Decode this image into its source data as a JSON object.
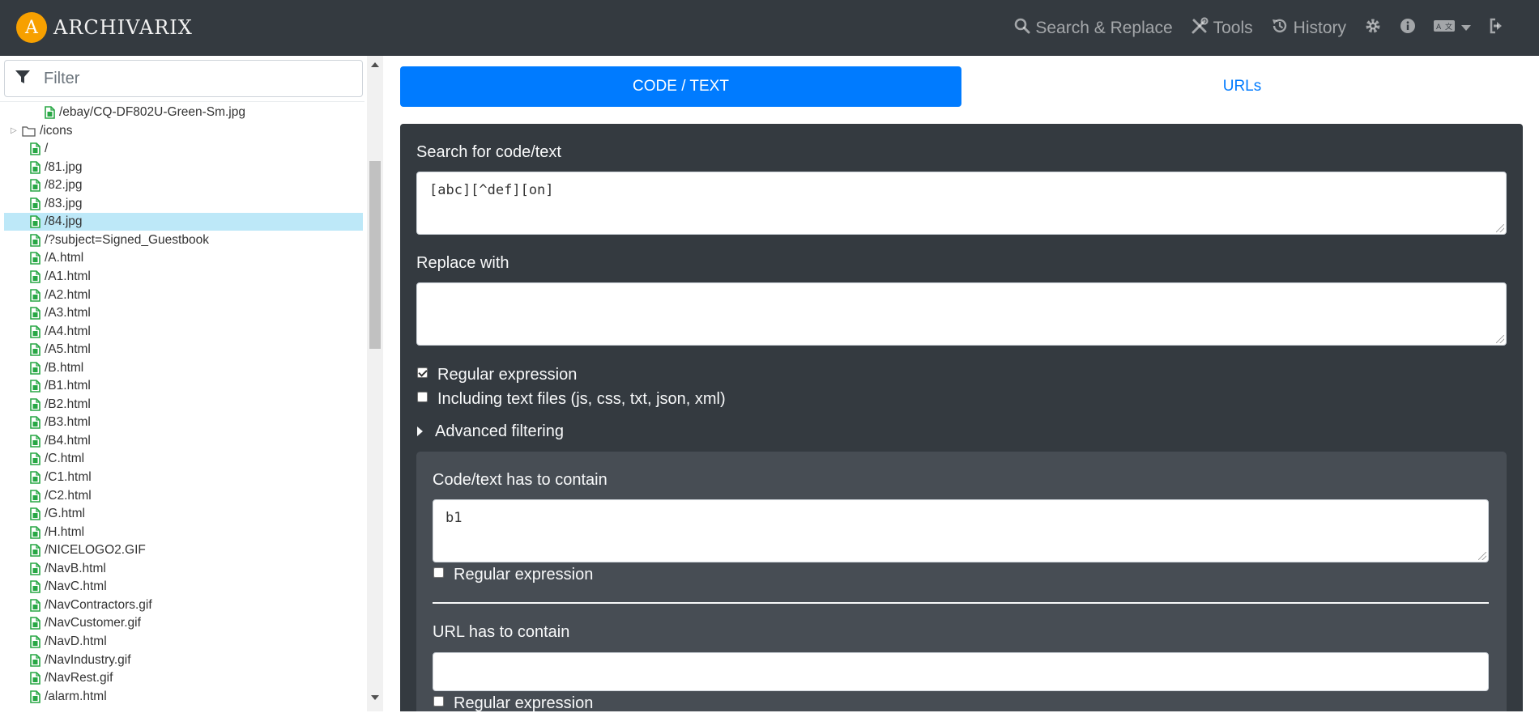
{
  "brand": {
    "logo_letter": "A",
    "name": "ARCHIVARIX",
    "logo_color": "#f7a000"
  },
  "nav": {
    "search_replace": "Search & Replace",
    "tools": "Tools",
    "history": "History"
  },
  "sidebar": {
    "filter_placeholder": "Filter",
    "items": [
      {
        "label": "/ebay/CQ-DF802U-Green-Sm.jpg",
        "type": "file",
        "indent": 2,
        "selected": false
      },
      {
        "label": "/icons",
        "type": "folder",
        "indent": 1,
        "selected": false
      },
      {
        "label": "/",
        "type": "file",
        "indent": 1,
        "selected": false
      },
      {
        "label": "/81.jpg",
        "type": "file",
        "indent": 1,
        "selected": false
      },
      {
        "label": "/82.jpg",
        "type": "file",
        "indent": 1,
        "selected": false
      },
      {
        "label": "/83.jpg",
        "type": "file",
        "indent": 1,
        "selected": false
      },
      {
        "label": "/84.jpg",
        "type": "file",
        "indent": 1,
        "selected": true
      },
      {
        "label": "/?subject=Signed_Guestbook",
        "type": "file",
        "indent": 1,
        "selected": false
      },
      {
        "label": "/A.html",
        "type": "file",
        "indent": 1,
        "selected": false
      },
      {
        "label": "/A1.html",
        "type": "file",
        "indent": 1,
        "selected": false
      },
      {
        "label": "/A2.html",
        "type": "file",
        "indent": 1,
        "selected": false
      },
      {
        "label": "/A3.html",
        "type": "file",
        "indent": 1,
        "selected": false
      },
      {
        "label": "/A4.html",
        "type": "file",
        "indent": 1,
        "selected": false
      },
      {
        "label": "/A5.html",
        "type": "file",
        "indent": 1,
        "selected": false
      },
      {
        "label": "/B.html",
        "type": "file",
        "indent": 1,
        "selected": false
      },
      {
        "label": "/B1.html",
        "type": "file",
        "indent": 1,
        "selected": false
      },
      {
        "label": "/B2.html",
        "type": "file",
        "indent": 1,
        "selected": false
      },
      {
        "label": "/B3.html",
        "type": "file",
        "indent": 1,
        "selected": false
      },
      {
        "label": "/B4.html",
        "type": "file",
        "indent": 1,
        "selected": false
      },
      {
        "label": "/C.html",
        "type": "file",
        "indent": 1,
        "selected": false
      },
      {
        "label": "/C1.html",
        "type": "file",
        "indent": 1,
        "selected": false
      },
      {
        "label": "/C2.html",
        "type": "file",
        "indent": 1,
        "selected": false
      },
      {
        "label": "/G.html",
        "type": "file",
        "indent": 1,
        "selected": false
      },
      {
        "label": "/H.html",
        "type": "file",
        "indent": 1,
        "selected": false
      },
      {
        "label": "/NICELOGO2.GIF",
        "type": "file",
        "indent": 1,
        "selected": false
      },
      {
        "label": "/NavB.html",
        "type": "file",
        "indent": 1,
        "selected": false
      },
      {
        "label": "/NavC.html",
        "type": "file",
        "indent": 1,
        "selected": false
      },
      {
        "label": "/NavContractors.gif",
        "type": "file",
        "indent": 1,
        "selected": false
      },
      {
        "label": "/NavCustomer.gif",
        "type": "file",
        "indent": 1,
        "selected": false
      },
      {
        "label": "/NavD.html",
        "type": "file",
        "indent": 1,
        "selected": false
      },
      {
        "label": "/NavIndustry.gif",
        "type": "file",
        "indent": 1,
        "selected": false
      },
      {
        "label": "/NavRest.gif",
        "type": "file",
        "indent": 1,
        "selected": false
      },
      {
        "label": "/alarm.html",
        "type": "file",
        "indent": 1,
        "selected": false
      }
    ]
  },
  "tabs": {
    "code_text": "CODE / TEXT",
    "urls": "URLs"
  },
  "form": {
    "search_label": "Search for code/text",
    "search_value": "[abc][^def][on]",
    "replace_label": "Replace with",
    "replace_value": "",
    "regex_label": "Regular expression",
    "regex_checked": true,
    "text_files_label": "Including text files (js, css, txt, json, xml)",
    "text_files_checked": false,
    "advanced_label": "Advanced filtering",
    "contain_label": "Code/text has to contain",
    "contain_value": "b1",
    "contain_regex_label": "Regular expression",
    "contain_regex_checked": false,
    "url_label": "URL has to contain",
    "url_value": "",
    "url_regex_label": "Regular expression",
    "url_regex_checked": false
  }
}
